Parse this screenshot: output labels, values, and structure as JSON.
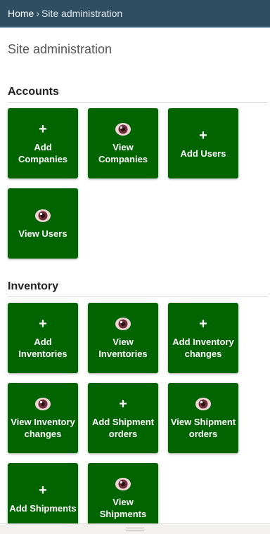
{
  "breadcrumb": {
    "home": "Home",
    "separator": "›",
    "current": "Site administration"
  },
  "page_title": "Site administration",
  "colors": {
    "tile": "#006400",
    "topbar": "#2f4e62"
  },
  "sections": {
    "accounts": {
      "title": "Accounts",
      "tiles": [
        {
          "icon": "plus-icon",
          "label": "Add Companies"
        },
        {
          "icon": "eye-icon",
          "label": "View Companies"
        },
        {
          "icon": "plus-icon",
          "label": "Add Users"
        },
        {
          "icon": "eye-icon",
          "label": "View Users"
        }
      ]
    },
    "inventory": {
      "title": "Inventory",
      "tiles": [
        {
          "icon": "plus-icon",
          "label": "Add Inventories"
        },
        {
          "icon": "eye-icon",
          "label": "View Inventories"
        },
        {
          "icon": "plus-icon",
          "label": "Add Inventory changes"
        },
        {
          "icon": "eye-icon",
          "label": "View Inventory changes"
        },
        {
          "icon": "plus-icon",
          "label": "Add Shipment orders"
        },
        {
          "icon": "eye-icon",
          "label": "View Shipment orders"
        },
        {
          "icon": "plus-icon",
          "label": "Add Shipments"
        },
        {
          "icon": "eye-icon",
          "label": "View Shipments"
        }
      ]
    }
  }
}
